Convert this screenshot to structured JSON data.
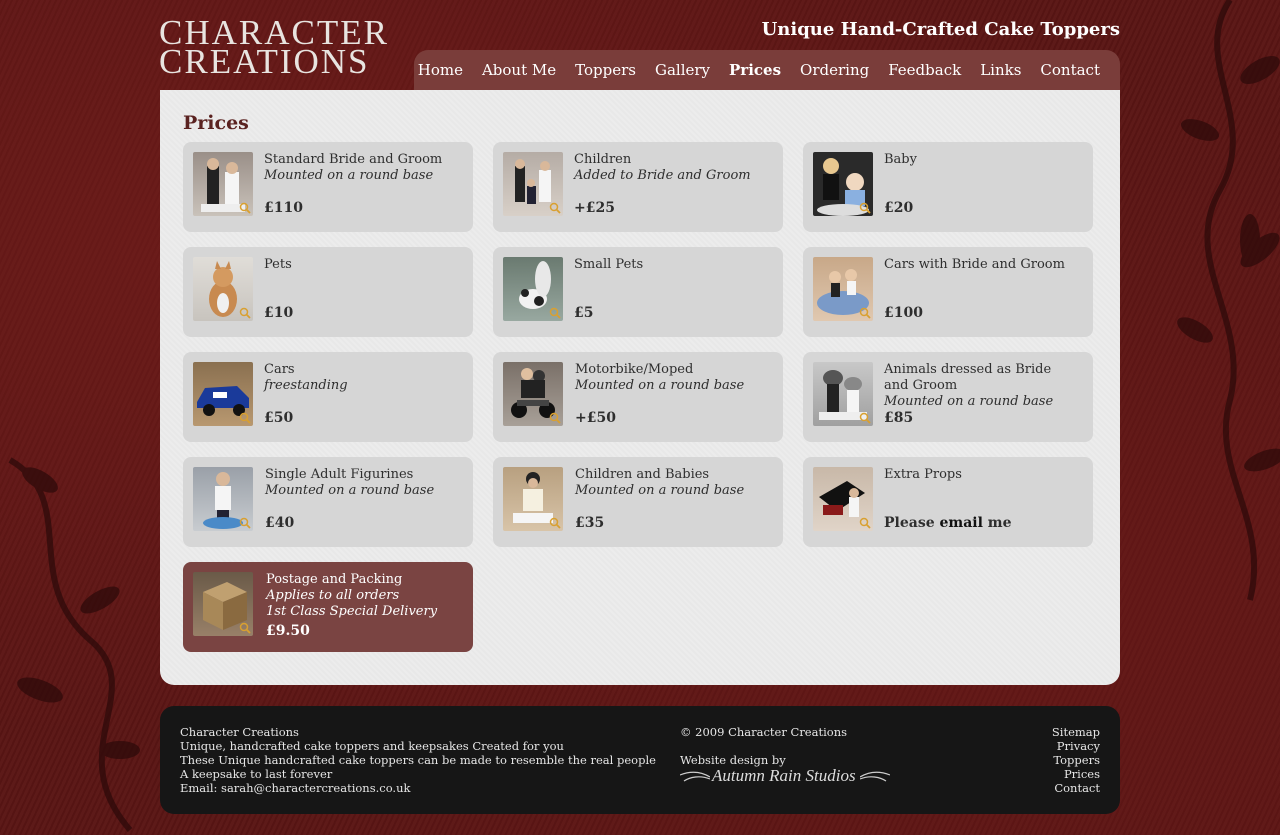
{
  "logo": {
    "line1": "CHARACTER",
    "line2": "CREATIONS"
  },
  "tagline": "Unique Hand-Crafted Cake Toppers",
  "nav": [
    {
      "label": "Home",
      "active": false
    },
    {
      "label": "About Me",
      "active": false
    },
    {
      "label": "Toppers",
      "active": false
    },
    {
      "label": "Gallery",
      "active": false
    },
    {
      "label": "Prices",
      "active": true
    },
    {
      "label": "Ordering",
      "active": false
    },
    {
      "label": "Feedback",
      "active": false
    },
    {
      "label": "Links",
      "active": false
    },
    {
      "label": "Contact",
      "active": false
    }
  ],
  "page_title": "Prices",
  "cards": [
    {
      "title": "Standard Bride and Groom",
      "sub": "Mounted on a round base",
      "price": "£110"
    },
    {
      "title": "Children",
      "sub": "Added to Bride and Groom",
      "price": "+£25"
    },
    {
      "title": "Baby",
      "sub": "",
      "price": "£20"
    },
    {
      "title": "Pets",
      "sub": "",
      "price": "£10"
    },
    {
      "title": "Small Pets",
      "sub": "",
      "price": "£5"
    },
    {
      "title": "Cars with Bride and Groom",
      "sub": "",
      "price": "£100"
    },
    {
      "title": "Cars",
      "sub": "freestanding",
      "price": "£50"
    },
    {
      "title": "Motorbike/Moped",
      "sub": "Mounted on a round base",
      "price": "+£50"
    },
    {
      "title": "Animals dressed as Bride and Groom",
      "sub": "Mounted on a round base",
      "price": "£85"
    },
    {
      "title": "Single Adult Figurines",
      "sub": "Mounted on a round base",
      "price": "£40"
    },
    {
      "title": "Children and Babies",
      "sub": "Mounted on a round base",
      "price": "£35"
    },
    {
      "title": "Extra Props",
      "sub": "",
      "price_prefix": "Please ",
      "price_link": "email",
      "price_suffix": " me"
    },
    {
      "title": "Postage and Packing",
      "sub": "Applies to all orders",
      "sub2": "1st Class Special Delivery",
      "price": "£9.50"
    }
  ],
  "footer": {
    "lines": [
      "Character Creations",
      "Unique, handcrafted cake toppers and keepsakes Created for you",
      "These Unique handcrafted cake toppers can be made to resemble the real people",
      "A keepsake to last forever",
      "Email: sarah@charactercreations.co.uk"
    ],
    "copyright": "© 2009 Character Creations",
    "design_by": "Website design by",
    "studio": "Autumn Rain Studios",
    "links": [
      "Sitemap",
      "Privacy",
      "Toppers",
      "Prices",
      "Contact"
    ]
  },
  "colors": {
    "background": "#5a1514",
    "nav": "#7a3d3a",
    "content": "#ececec",
    "card": "#d6d6d6",
    "highlight_card": "#7a4442",
    "footer": "#161616",
    "title": "#5a2220"
  }
}
